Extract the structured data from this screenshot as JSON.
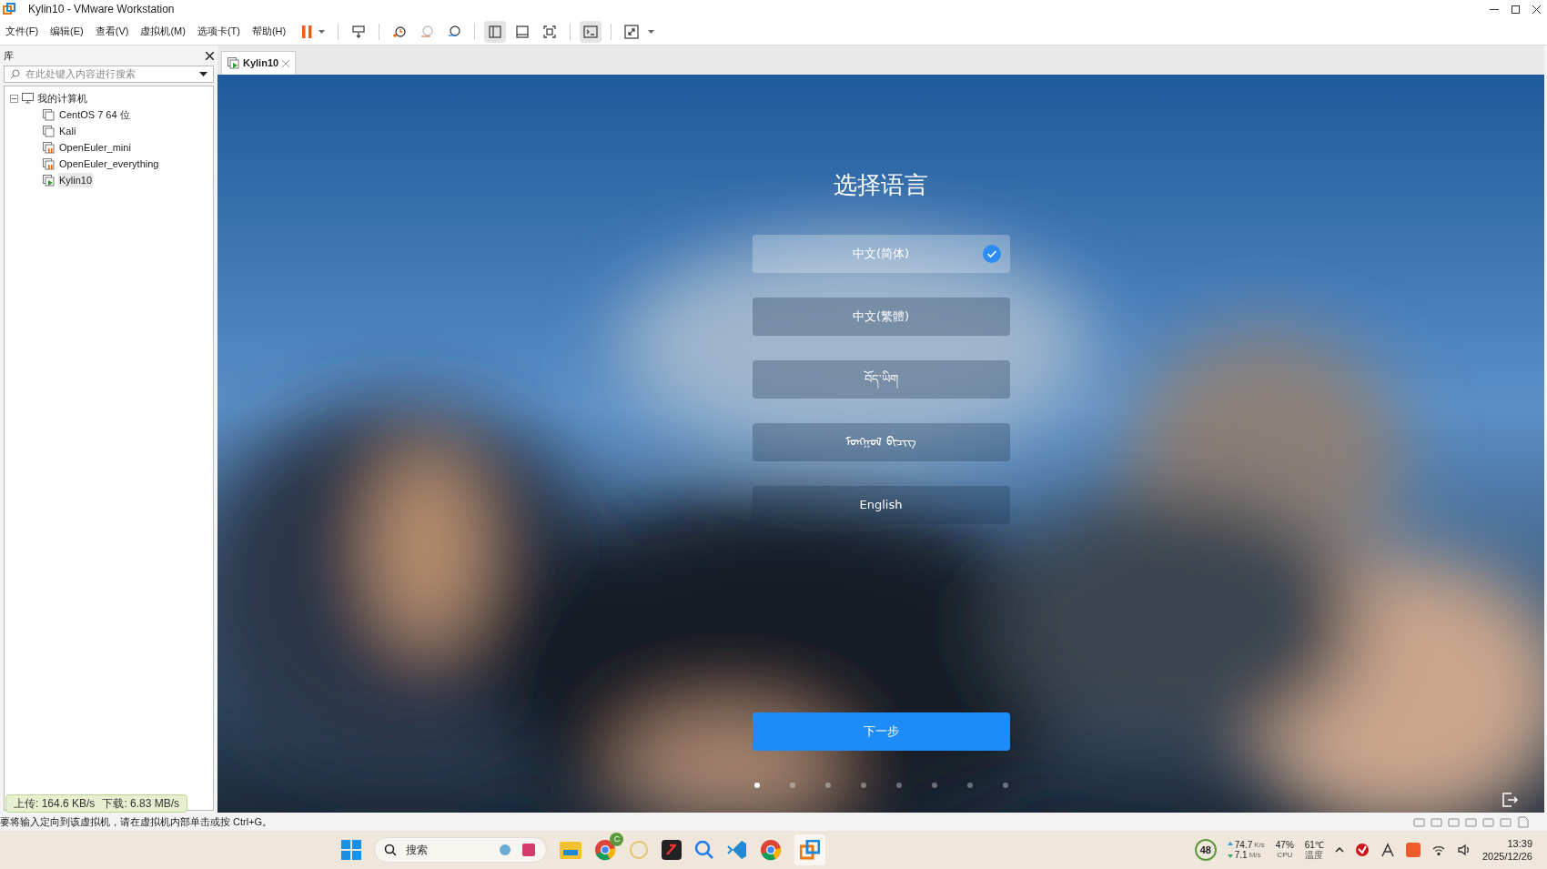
{
  "window": {
    "title": "Kylin10 - VMware Workstation"
  },
  "menu": [
    "文件(F)",
    "编辑(E)",
    "查看(V)",
    "虚拟机(M)",
    "选项卡(T)",
    "帮助(H)"
  ],
  "library": {
    "title": "库",
    "search": {
      "placeholder": "在此处键入内容进行搜索"
    },
    "tree": [
      {
        "label": "我的计算机",
        "expanded": true,
        "children": [
          {
            "label": "CentOS 7 64 位",
            "kind": "off",
            "selected": false
          },
          {
            "label": "Kali",
            "kind": "off",
            "selected": false
          },
          {
            "label": "OpenEuler_mini",
            "kind": "suspended",
            "selected": false
          },
          {
            "label": "OpenEuler_everything",
            "kind": "suspended",
            "selected": false
          },
          {
            "label": "Kylin10",
            "kind": "running",
            "selected": true
          }
        ]
      }
    ]
  },
  "tabs": [
    {
      "label": "Kylin10",
      "selected": true
    }
  ],
  "guest": {
    "title": "选择语言",
    "languages": [
      {
        "label": "中文(简体)",
        "selected": true
      },
      {
        "label": "中文(繁體)",
        "selected": false
      },
      {
        "label": "བོད་ཡིག",
        "selected": false
      },
      {
        "label": "ᠮᠣᠩᠭᠣᠯ ᠪᠢᠴᠢᠭ",
        "selected": false
      },
      {
        "label": "English",
        "selected": false
      }
    ],
    "next_button": "下一步",
    "pager": [
      {
        "selected": true
      },
      {
        "selected": false
      },
      {
        "selected": false
      },
      {
        "selected": false
      },
      {
        "selected": false
      },
      {
        "selected": false
      },
      {
        "selected": false
      },
      {
        "selected": false
      }
    ]
  },
  "net_overlay": {
    "upload": "上传: 164.6 KB/s",
    "download": "下载: 6.83 MB/s"
  },
  "status_bar": "要将输入定向到该虚拟机，请在虚拟机内部单击或按 Ctrl+G。",
  "taskbar": {
    "search": {
      "placeholder": "搜索"
    },
    "badge": "C",
    "tray": {
      "score": "48",
      "up": "74.7",
      "up_unit": "K/s",
      "down": "7.1",
      "down_unit": "M/s",
      "cpu": "47%",
      "cpu_label": "CPU",
      "temp": "61℃",
      "temp_label": "温度",
      "time": "13:39",
      "date": "2025/12/26"
    }
  }
}
